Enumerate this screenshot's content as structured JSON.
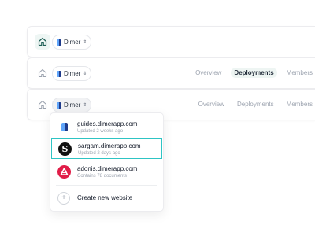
{
  "rows": [
    {
      "project": "Dimer",
      "tabs": []
    },
    {
      "project": "Dimer",
      "tabs": [
        {
          "label": "Overview",
          "active": false
        },
        {
          "label": "Deployments",
          "active": true
        },
        {
          "label": "Members",
          "active": false
        }
      ]
    },
    {
      "project": "Dimer",
      "tabs": [
        {
          "label": "Overview",
          "active": false
        },
        {
          "label": "Deployments",
          "active": false
        },
        {
          "label": "Members",
          "active": false
        }
      ]
    }
  ],
  "dropdown": {
    "sites": [
      {
        "domain": "guides.dimerapp.com",
        "meta": "Updated 2 weeks ago",
        "icon": "dimer-logo-icon",
        "selected": false
      },
      {
        "domain": "sargam.dimerapp.com",
        "meta": "Updated 2 days ago",
        "icon": "sargam-logo-icon",
        "glyph": "S",
        "selected": true
      },
      {
        "domain": "adonis.dimerapp.com",
        "meta": "Contains 78 documents",
        "icon": "adonis-logo-icon",
        "selected": false
      }
    ],
    "create_label": "Create new website"
  },
  "colors": {
    "accent_teal": "#2ec4c4",
    "active_home": "#1f5f56",
    "adonis_red": "#e11d48"
  }
}
